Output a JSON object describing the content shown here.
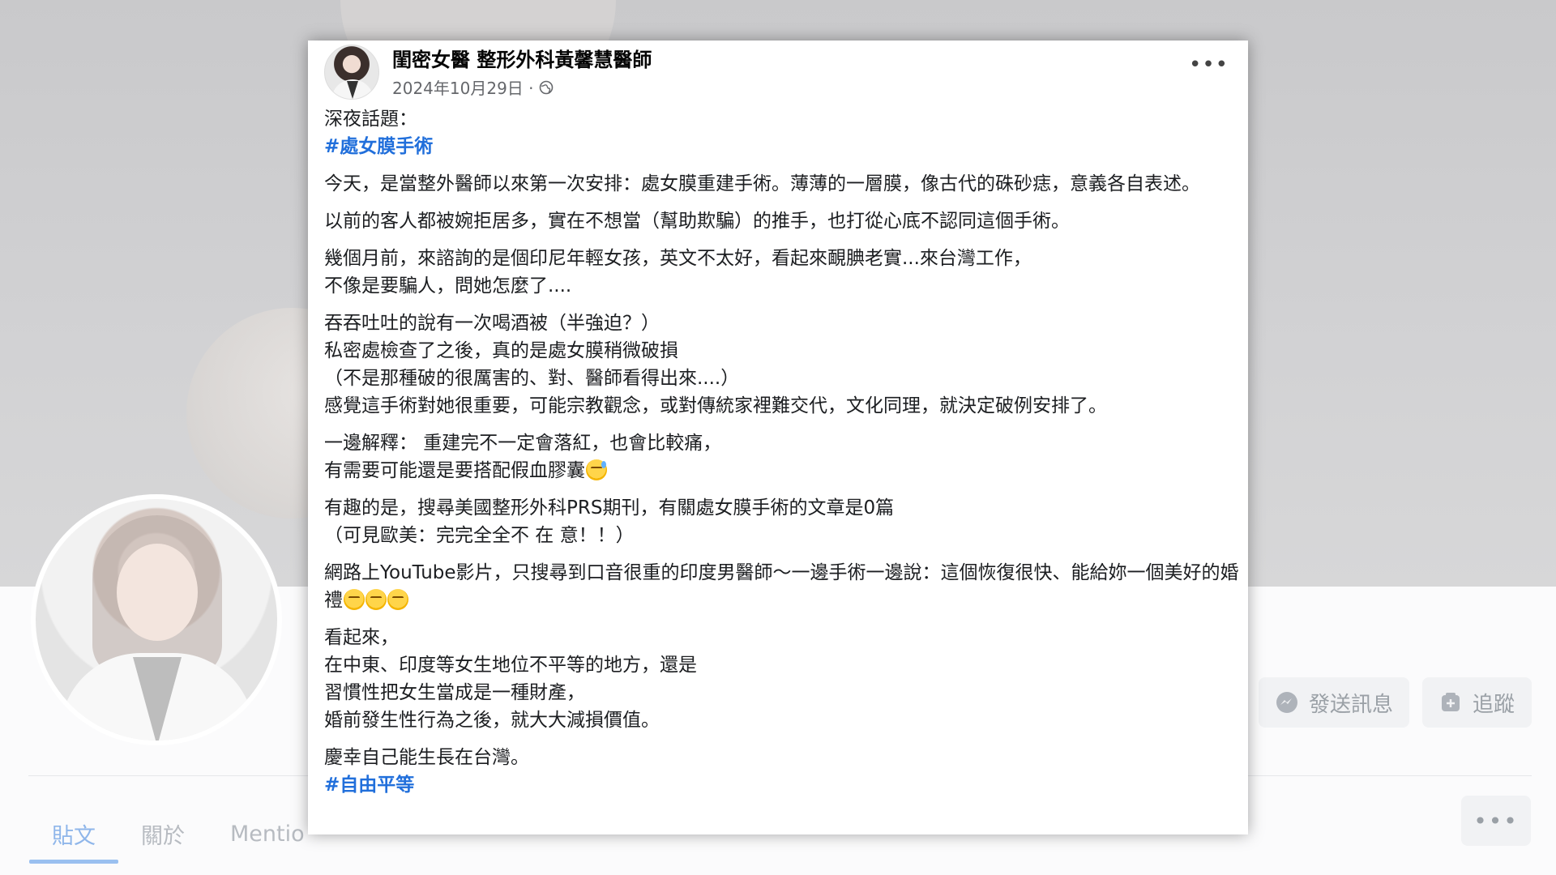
{
  "profile_tabs": {
    "posts": "貼文",
    "about": "關於",
    "mentions": "Mentio"
  },
  "profile_actions": {
    "message": "發送訊息",
    "follow": "追蹤"
  },
  "post": {
    "author": "閨密女醫 整形外科黃馨慧醫師",
    "date": "2024年10月29日 ·",
    "more": "•••",
    "paragraphs": {
      "p1_line1": "深夜話題：",
      "p1_hashtag": "#處女膜手術",
      "p2": "今天，是當整外醫師以來第一次安排：處女膜重建手術。薄薄的一層膜，像古代的硃砂痣，意義各自表述。",
      "p3": "以前的客人都被婉拒居多，實在不想當（幫助欺騙）的推手，也打從心底不認同這個手術。",
      "p4": "幾個月前，來諮詢的是個印尼年輕女孩，英文不太好，看起來靦腆老實...來台灣工作，\n不像是要騙人，問她怎麼了....",
      "p5": "吞吞吐吐的說有一次喝酒被（半強迫？）\n私密處檢查了之後，真的是處女膜稍微破損\n（不是那種破的很厲害的、對、醫師看得出來....）\n感覺這手術對她很重要，可能宗教觀念，或對傳統家裡難交代，文化同理，就決定破例安排了。",
      "p6_text": "一邊解釋： 重建完不一定會落紅，也會比較痛，\n有需要可能還是要搭配假血膠囊",
      "p7": "有趣的是，搜尋美國整形外科PRS期刊，有關處女膜手術的文章是0篇\n（可見歐美：完完全全不 在 意！！）",
      "p8_text": "網路上YouTube影片，只搜尋到口音很重的印度男醫師～一邊手術一邊說：這個恢復很快、能給妳一個美好的婚禮",
      "p9": "看起來，\n在中東、印度等女生地位不平等的地方，還是\n習慣性把女生當成是一種財產，\n婚前發生性行為之後，就大大減損價值。",
      "p10_line1": "慶幸自己能生長在台灣。",
      "p10_hashtag": "#自由平等"
    }
  },
  "colors": {
    "hashtag": "#216fdb",
    "tab_active": "#8fb6ea",
    "text": "#1c1e21",
    "meta": "#65676b"
  },
  "icons": {
    "post_more": "more-dots-icon",
    "privacy": "globe-icon",
    "message": "messenger-icon",
    "follow": "follow-icon",
    "emoji_sweat": "grinning-sweat-emoji",
    "emoji_eyeroll": "rolling-eyes-emoji"
  }
}
